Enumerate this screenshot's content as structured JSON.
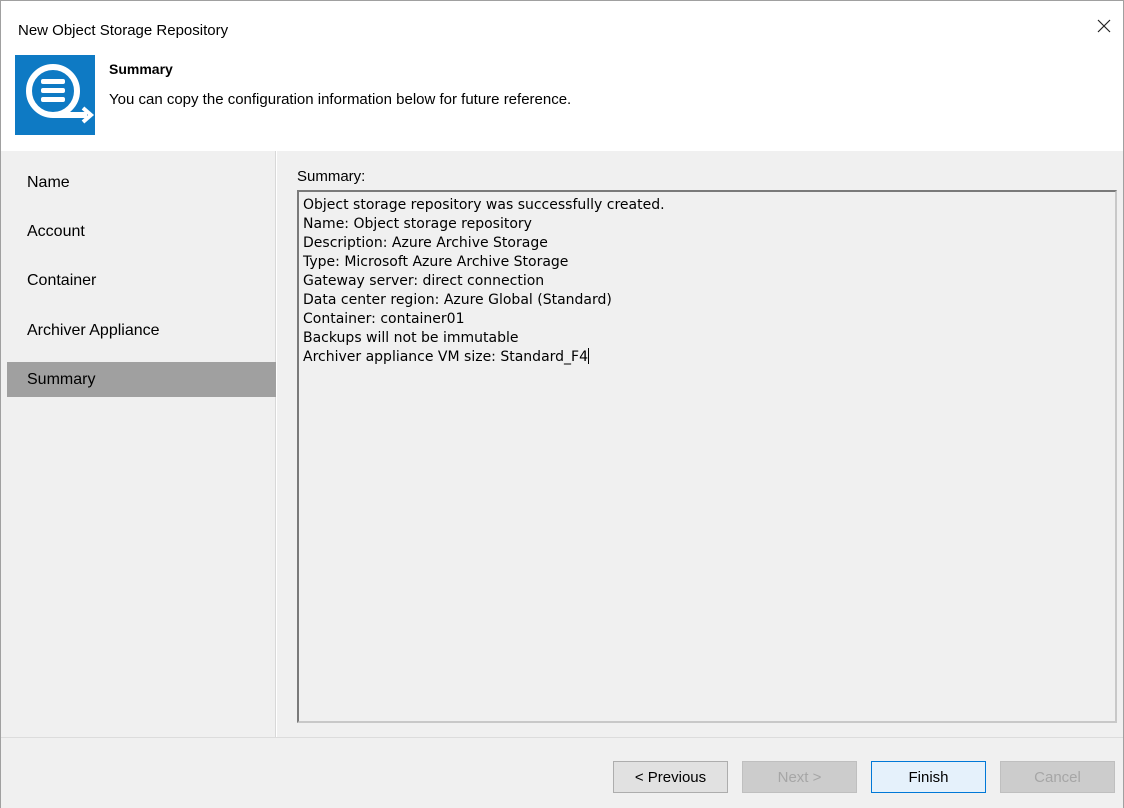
{
  "window": {
    "title": "New Object Storage Repository"
  },
  "header": {
    "title": "Summary",
    "subtitle": "You can copy the configuration information below for future reference.",
    "icon": "repository-icon",
    "accent_color": "#0e7ac4"
  },
  "sidebar": {
    "items": [
      {
        "label": "Name",
        "active": false
      },
      {
        "label": "Account",
        "active": false
      },
      {
        "label": "Container",
        "active": false
      },
      {
        "label": "Archiver Appliance",
        "active": false
      },
      {
        "label": "Summary",
        "active": true
      }
    ]
  },
  "main": {
    "summary_label": "Summary:",
    "summary_lines": [
      "Object storage repository was successfully created.",
      "Name: Object storage repository",
      "Description: Azure Archive Storage",
      "Type: Microsoft Azure Archive Storage",
      "Gateway server: direct connection",
      "Data center region: Azure Global (Standard)",
      "Container: container01",
      "Backups will not be immutable",
      "Archiver appliance VM size: Standard_F4"
    ]
  },
  "footer": {
    "previous_label": "< Previous",
    "next_label": "Next >",
    "finish_label": "Finish",
    "cancel_label": "Cancel"
  }
}
